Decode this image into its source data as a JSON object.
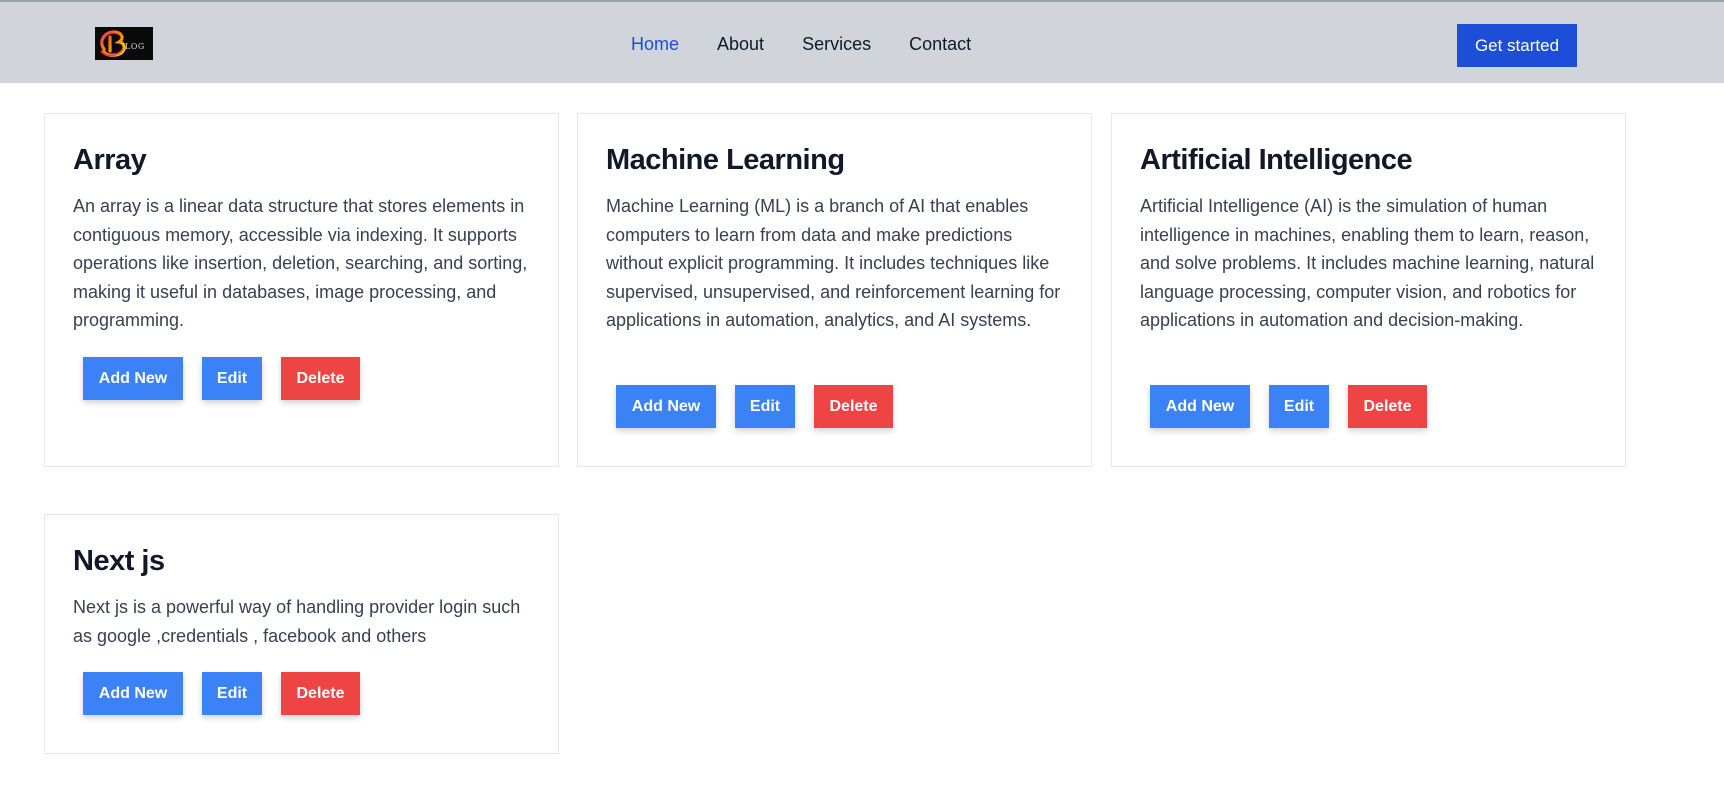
{
  "header": {
    "logo_text": "LOG",
    "nav": [
      {
        "label": "Home"
      },
      {
        "label": "About"
      },
      {
        "label": "Services"
      },
      {
        "label": "Contact"
      }
    ],
    "cta_label": "Get started"
  },
  "colors": {
    "header_bg": "#d1d5db",
    "accent": "#1d4ed8",
    "button_blue": "#3b82f6",
    "button_red": "#ef4444"
  },
  "cards": [
    {
      "title": "Array",
      "body": "An array is a linear data structure that stores elements in contiguous memory, accessible via indexing. It supports operations like insertion, deletion, searching, and sorting, making it useful in databases, image processing, and programming.",
      "add_label": "Add New",
      "edit_label": "Edit",
      "delete_label": "Delete"
    },
    {
      "title": "Machine Learning",
      "body": "Machine Learning (ML) is a branch of AI that enables computers to learn from data and make predictions without explicit programming. It includes techniques like supervised, unsupervised, and reinforcement learning for applications in automation, analytics, and AI systems.",
      "add_label": "Add New",
      "edit_label": "Edit",
      "delete_label": "Delete"
    },
    {
      "title": "Artificial Intelligence",
      "body": "Artificial Intelligence (AI) is the simulation of human intelligence in machines, enabling them to learn, reason, and solve problems. It includes machine learning, natural language processing, computer vision, and robotics for applications in automation and decision-making.",
      "add_label": "Add New",
      "edit_label": "Edit",
      "delete_label": "Delete"
    },
    {
      "title": "Next js",
      "body": "Next js is a powerful way of handling provider login such as google ,credentials , facebook and others",
      "add_label": "Add New",
      "edit_label": "Edit",
      "delete_label": "Delete"
    }
  ]
}
